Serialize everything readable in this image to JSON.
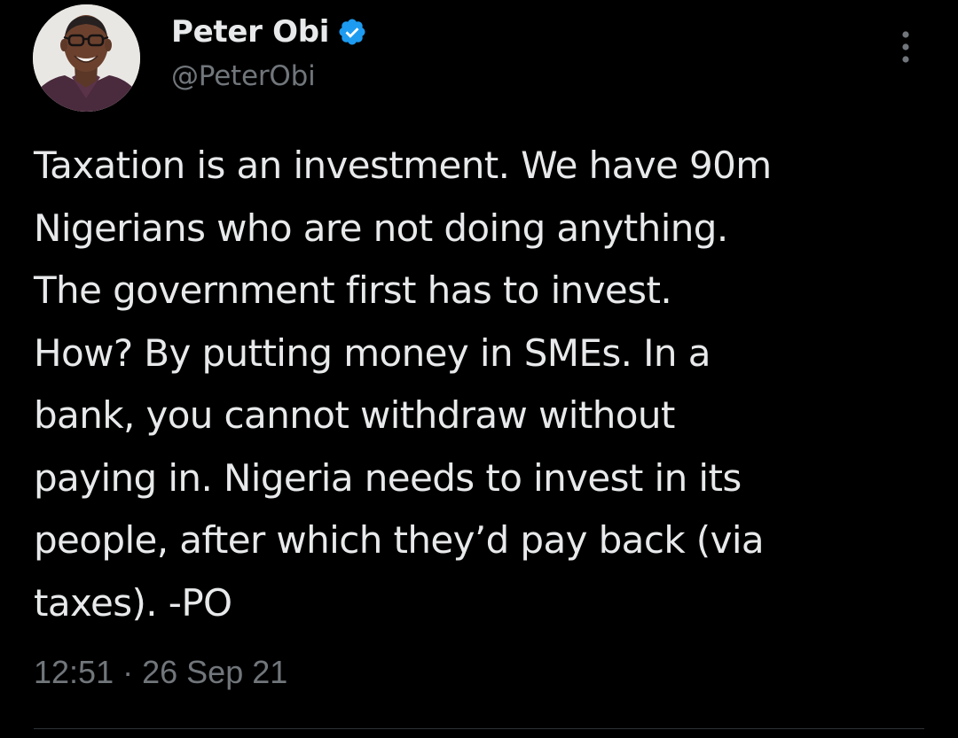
{
  "tweet": {
    "author": {
      "display_name": "Peter Obi",
      "handle": "@PeterObi",
      "verified": true,
      "avatar_icon": "profile-photo"
    },
    "text_lines": [
      "Taxation is an investment. We have 90m",
      "Nigerians who are not doing anything.",
      "The government first has to invest.",
      "How? By putting money in SMEs. In a",
      "bank, you cannot withdraw without",
      "paying in. Nigeria needs to invest in its",
      "people, after which they’d pay back (via",
      "taxes). -PO"
    ],
    "timestamp": {
      "time": "12:51",
      "separator": "·",
      "date": "26 Sep 21"
    },
    "more_icon": "more-vertical-icon"
  },
  "colors": {
    "background": "#000000",
    "primary_text": "#e7e9ea",
    "secondary_text": "#71767b",
    "verified_badge": "#1d9bf0",
    "divider": "#2f3336"
  }
}
